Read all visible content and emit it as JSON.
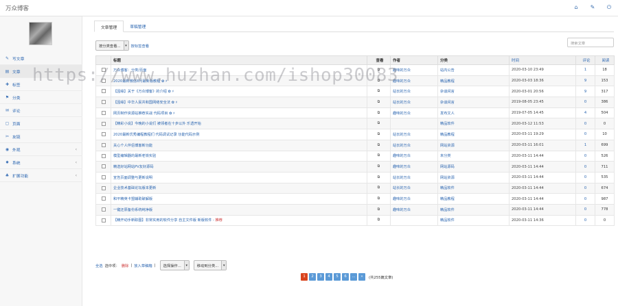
{
  "app": {
    "title": "万众博客"
  },
  "topbar": {
    "icons": [
      "home-icon",
      "wrench-icon",
      "power-icon"
    ],
    "glyphs": [
      "⌂",
      "✎",
      "⏻"
    ]
  },
  "sidebar": {
    "items": [
      {
        "label": "写文章",
        "icon": "edit-icon",
        "glyph": "✎",
        "arrow": ""
      },
      {
        "label": "文章",
        "icon": "list-icon",
        "glyph": "▤",
        "arrow": ""
      },
      {
        "label": "标签",
        "icon": "tag-icon",
        "glyph": "✚",
        "arrow": ""
      },
      {
        "label": "分类",
        "icon": "flag-icon",
        "glyph": "⚑",
        "arrow": ""
      },
      {
        "label": "评论",
        "icon": "comment-icon",
        "glyph": "✉",
        "arrow": ""
      },
      {
        "label": "页面",
        "icon": "file-icon",
        "glyph": "▢",
        "arrow": ""
      },
      {
        "label": "友链",
        "icon": "link-icon",
        "glyph": "✂",
        "arrow": ""
      },
      {
        "label": "外观",
        "icon": "eye-icon",
        "glyph": "◉",
        "arrow": "‹"
      },
      {
        "label": "系统",
        "icon": "gear-icon",
        "glyph": "✸",
        "arrow": "‹"
      },
      {
        "label": "扩展功能",
        "icon": "sitemap-icon",
        "glyph": "♣",
        "arrow": "‹"
      }
    ]
  },
  "tabs": [
    "文章管理",
    "草稿管理"
  ],
  "filter": {
    "select_value": "按分类查看...",
    "link": "按标签查看"
  },
  "search": {
    "placeholder": "搜索文章"
  },
  "table": {
    "headers": [
      "标题",
      "查看",
      "作者",
      "分类",
      "时间",
      "评论",
      "阅读"
    ],
    "rows": [
      {
        "title": "万众博客：分类/页面",
        "author": "趣味的万众",
        "category": "站内公告",
        "time": "2020-03-10 23:49",
        "comments": "1",
        "reads": "18"
      },
      {
        "title": "2020最新微信8月最新版教程 ✿ ♯",
        "author": "趣味的万众",
        "category": "精品教程",
        "time": "2020-03-03 18:36",
        "comments": "9",
        "reads": "153"
      },
      {
        "title": "【因缘】关于《万众博客》的介绍 ✿ ♯",
        "author": "站长的万众",
        "category": "杂谈闲言",
        "time": "2020-03-01 20:56",
        "comments": "9",
        "reads": "317"
      },
      {
        "title": "【因缘】中华人民共和国网络安全法 ✿ ♯",
        "author": "站长的万众",
        "category": "杂谈闲言",
        "time": "2019-08-05 23:45",
        "comments": "0",
        "reads": "386"
      },
      {
        "title": "网页制作资源站推荐实战 代码项目 ✿ ♯",
        "author": "趣味的万众",
        "category": "发布文人",
        "time": "2019-07-05 14:45",
        "comments": "4",
        "reads": "504"
      },
      {
        "title": "【精彩小说】今晚的小说们 被领者在十步以外 乐透开始",
        "author": "",
        "category": "精品软件",
        "time": "2020-03-12 11:53",
        "comments": "0",
        "reads": "0"
      },
      {
        "title": "2020最新优秀编程教程们 代码调试记录 功能代码示例",
        "author": "站长的万众",
        "category": "精品教程",
        "time": "2020-03-11 19:29",
        "comments": "0",
        "reads": "10"
      },
      {
        "title": "关心个人伴侣博客新功能",
        "author": "站长的万众",
        "category": "网站资源",
        "time": "2020-03-11 16:01",
        "comments": "1",
        "reads": "699"
      },
      {
        "title": "模型编辑器的最新老铁实验",
        "author": "趣味的万众",
        "category": "未分类",
        "time": "2020-03-11 14:44",
        "comments": "0",
        "reads": "526"
      },
      {
        "title": "精选好站网站PV友好源码",
        "author": "趣味的万众",
        "category": "网站源码",
        "time": "2020-03-11 14:44",
        "comments": "0",
        "reads": "711"
      },
      {
        "title": "宣告页面调整与更新说明",
        "author": "站长的万众",
        "category": "网站资源",
        "time": "2020-03-11 14:44",
        "comments": "0",
        "reads": "535"
      },
      {
        "title": "企业技术基础论坛版本更新",
        "author": "站长的万众",
        "category": "精品软件",
        "time": "2020-03-11 14:44",
        "comments": "0",
        "reads": "674"
      },
      {
        "title": "和平精英卡盟辅助破解版",
        "author": "趣味的万众",
        "category": "精品教程",
        "time": "2020-03-11 14:44",
        "comments": "0",
        "reads": "987"
      },
      {
        "title": "一键还原备份系统纯净版",
        "author": "趣味的万众",
        "category": "精品软件",
        "time": "2020-03-11 14:44",
        "comments": "0",
        "reads": "778"
      },
      {
        "title": "【精开动手新职图】非常实用的软件分享 自主文件版 新版软件 - ",
        "tag": "推荐",
        "author": "",
        "category": "精品软件",
        "time": "2020-03-11 14:36",
        "comments": "0",
        "reads": "0"
      }
    ]
  },
  "bottom": {
    "all": "全选",
    "selected": "选中项：",
    "delete": "删除",
    "sep": "|",
    "recycle": "放入草稿箱",
    "sep2": "|",
    "op_select": "选择操作...",
    "move_select": "移动到分类..."
  },
  "pager": {
    "pages": [
      "1",
      "2",
      "3",
      "4",
      "5",
      "6",
      "..."
    ],
    "next": "»",
    "total": "(共255篇文章)"
  },
  "watermark": "https://www.huzhan.com/ishop30083"
}
